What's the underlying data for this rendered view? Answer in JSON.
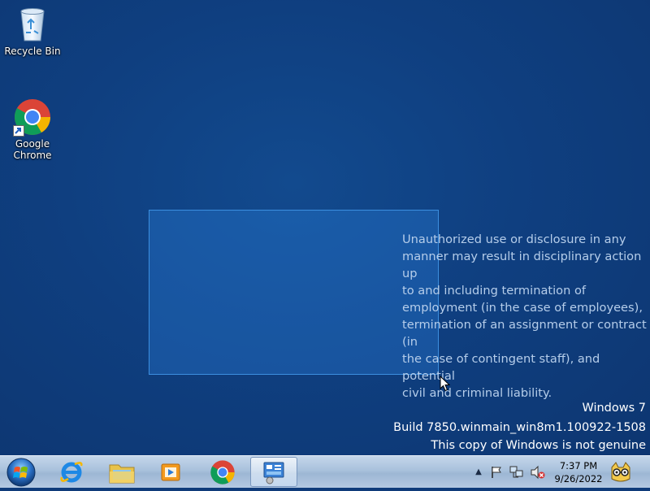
{
  "desktop": {
    "icons": [
      {
        "label": "Recycle Bin",
        "icon": "recycle-bin-icon"
      },
      {
        "label": "Google Chrome",
        "label_line1": "Google",
        "label_line2": "Chrome",
        "icon": "chrome-icon"
      }
    ],
    "notice_lines": [
      "Unauthorized use or disclosure in any",
      "manner may result in disciplinary action up",
      "to and including termination of",
      "employment (in the case of employees),",
      "termination of an assignment or contract (in",
      "the case of contingent staff), and potential",
      "civil and criminal liability."
    ],
    "watermark": {
      "os": "Windows 7",
      "build": "Build 7850.winmain_win8m1.100922-1508",
      "genuine": "This copy of Windows is not genuine"
    }
  },
  "taskbar": {
    "start_icon": "windows-orb-icon",
    "pinned": [
      {
        "name": "internet-explorer",
        "icon": "internet-explorer-icon"
      },
      {
        "name": "windows-explorer",
        "icon": "folder-icon"
      },
      {
        "name": "media-player",
        "icon": "media-player-icon"
      },
      {
        "name": "google-chrome",
        "icon": "chrome-icon"
      },
      {
        "name": "control-panel",
        "icon": "control-panel-icon",
        "active": true
      }
    ],
    "tray": {
      "icons": [
        "show-hidden-icons",
        "action-center-flag-icon",
        "network-icon",
        "volume-muted-icon"
      ],
      "time": "7:37 PM",
      "date": "9/26/2022"
    },
    "colors": {
      "accent": "#0f3b7a",
      "selection": "#3399ff"
    }
  }
}
